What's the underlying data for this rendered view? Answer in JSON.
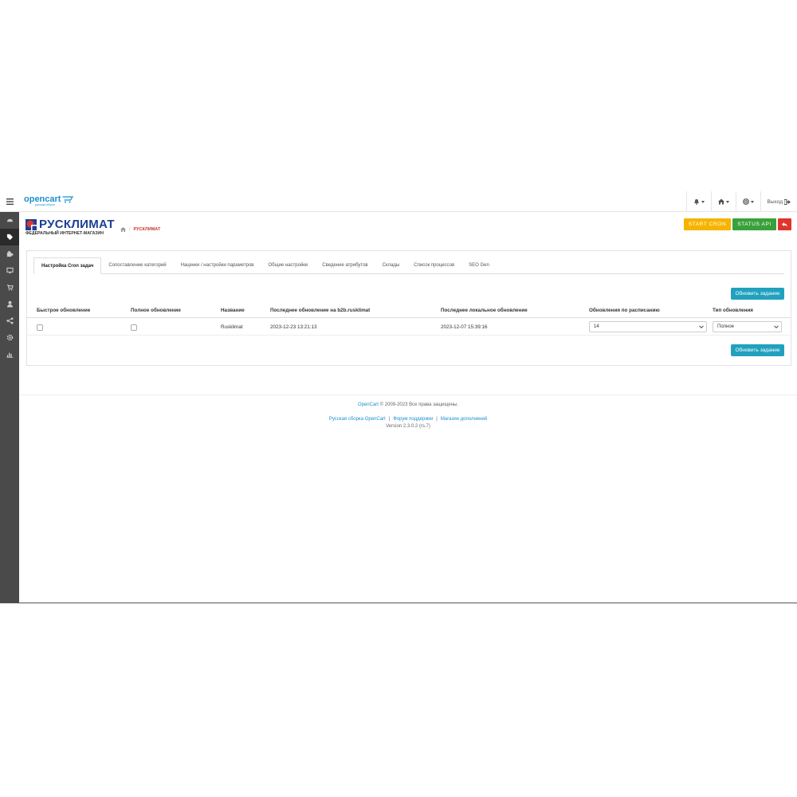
{
  "header": {
    "brand": "opencart",
    "brand_sub": "русская сборка",
    "logout_label": "Выход"
  },
  "page": {
    "logo_name": "РУСКЛИМАТ",
    "logo_subtitle": "ФЕДЕРАЛЬНЫЙ ИНТЕРНЕТ-МАГАЗИН",
    "breadcrumb": "РУСКЛИМАТ",
    "start_cron_label": "START CRON",
    "status_api_label": "STATUS API"
  },
  "tabs": [
    {
      "label": "Настройка Cron задач"
    },
    {
      "label": "Сопоставление категорий"
    },
    {
      "label": "Наценки / настройки параметров"
    },
    {
      "label": "Общие настройки"
    },
    {
      "label": "Сведение атрибутов"
    },
    {
      "label": "Склады"
    },
    {
      "label": "Список процессов"
    },
    {
      "label": "SEO Gen"
    }
  ],
  "table": {
    "update_button_label": "Обновить задание",
    "columns": [
      "Быстрое обновление",
      "Полное обновление",
      "Название",
      "Последнее обновление на b2b.rusklimat",
      "Последнее локальное обновление",
      "Обновления по расписанию",
      "Тип обновления"
    ],
    "rows": [
      {
        "quick_update": false,
        "full_update": false,
        "name": "Rusklimat",
        "last_remote_update": "2023-12-23 13:21:13",
        "last_local_update": "2023-12-07 15:39:16",
        "schedule": "14",
        "update_type": "Полное"
      }
    ]
  },
  "footer": {
    "link_opencart": "OpenCart",
    "copyright": "© 2009-2023 Все права защищены.",
    "link_ru_build": "Русская сборка OpenCart",
    "link_forum": "Форум поддержки",
    "link_market": "Магазин дополнений",
    "version": "Version 2.3.0.2 (rs.7)"
  },
  "colors": {
    "accent": "#21a1be",
    "start_cron": "#f6b400",
    "status_api": "#3aa13a",
    "back": "#e0342d",
    "sidebar": "#4a4a4a"
  },
  "icons": {
    "sidebar": [
      "menu-icon",
      "dashboard-icon",
      "tag-icon",
      "puzzle-icon",
      "desktop-icon",
      "cart-icon",
      "user-icon",
      "share-icon",
      "cog-icon",
      "bar-chart-icon"
    ]
  }
}
